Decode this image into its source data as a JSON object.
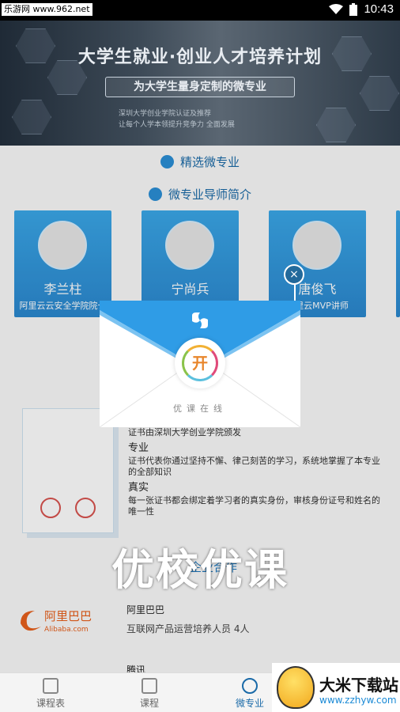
{
  "status_bar": {
    "watermark": "乐游网 www.962.net",
    "time": "10:43"
  },
  "banner": {
    "title": "大学生就业·创业人才培养计划",
    "pill": "为大学生量身定制的微专业",
    "sub_line1": "深圳大学创业学院认证及推荐",
    "sub_line2": "让每个人学本领提升竞争力 全面发展"
  },
  "sections": {
    "featured": "精选微专业",
    "mentors": "微专业导师简介"
  },
  "mentors": [
    {
      "name": "李兰柱",
      "role": "阿里云云安全学院院长"
    },
    {
      "name": "宁尚兵",
      "role": ""
    },
    {
      "name": "唐俊飞",
      "role": "阿里云MVP讲师"
    }
  ],
  "certificate": {
    "issued_by": "证书由深圳大学创业学院颁发",
    "pro_title": "专业",
    "pro_desc": "证书代表你通过坚持不懈、律己刻苦的学习，系统地掌握了本专业的全部知识",
    "real_title": "真实",
    "real_desc": "每一张证书都会绑定着学习者的真实身份，审核身份证号和姓名的唯一性"
  },
  "partners": {
    "link": "企业合作",
    "logo_cn": "阿里巴巴",
    "logo_en": "Alibaba.com",
    "name": "阿里巴巴",
    "desc": "互联网产品运营培养人员 4人",
    "next": "腾讯"
  },
  "popup": {
    "seal_char": "开",
    "caption": "优课在线",
    "close_symbol": "×"
  },
  "overlay_caption": "优校优课",
  "tabs": [
    {
      "label": "课程表"
    },
    {
      "label": "课程"
    },
    {
      "label": "微专业"
    }
  ],
  "watermark_br": {
    "title": "大米下载站",
    "url": "www.zzhyw.com"
  },
  "colors": {
    "accent": "#1a6aa8",
    "card_blue": "#2b88cf",
    "envelope_blue": "#2f9ce6"
  }
}
